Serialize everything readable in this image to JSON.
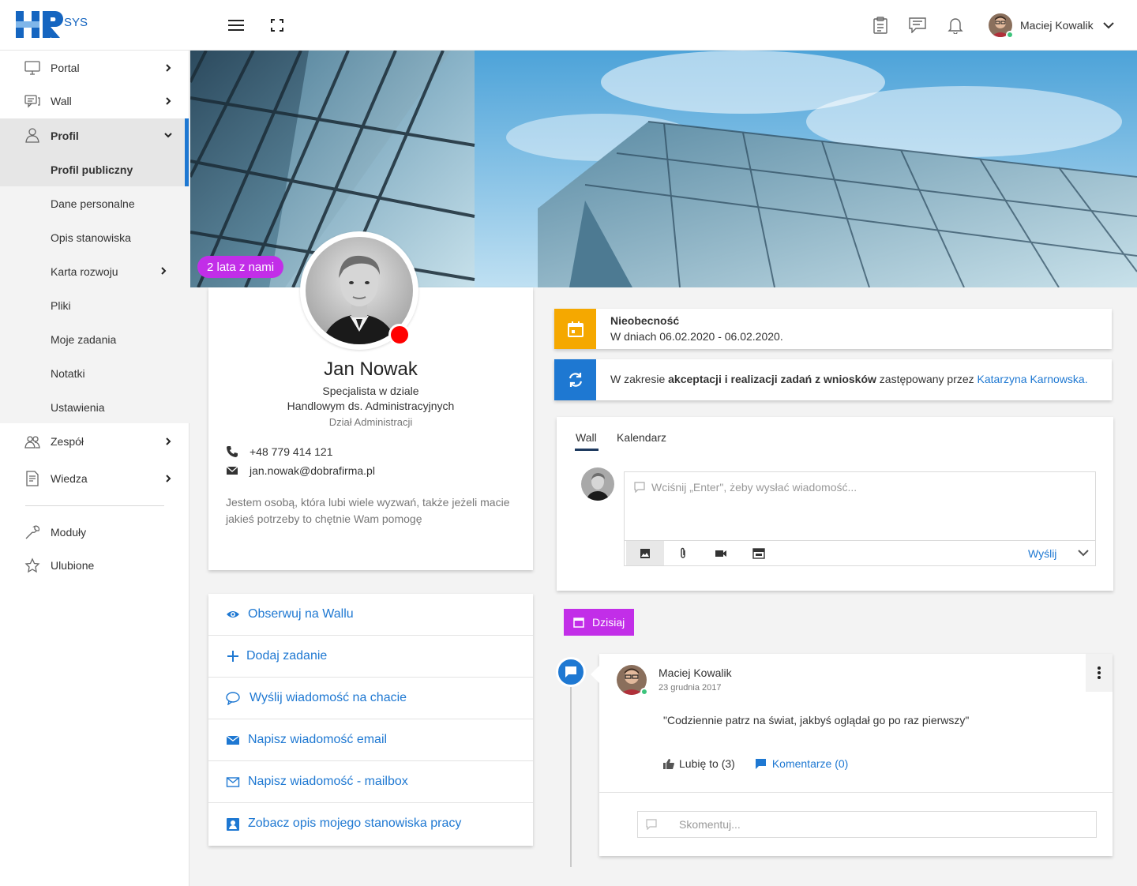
{
  "header": {
    "logo_text": "HR",
    "logo_suffix": "SYS",
    "user_name": "Maciej Kowalik"
  },
  "sidebar": {
    "items": [
      {
        "label": "Portal"
      },
      {
        "label": "Wall"
      },
      {
        "label": "Profil"
      },
      {
        "label": "Zespół"
      },
      {
        "label": "Wiedza"
      },
      {
        "label": "Moduły"
      },
      {
        "label": "Ulubione"
      }
    ],
    "sub_items": [
      {
        "label": "Profil publiczny"
      },
      {
        "label": "Dane personalne"
      },
      {
        "label": "Opis stanowiska"
      },
      {
        "label": "Karta rozwoju"
      },
      {
        "label": "Pliki"
      },
      {
        "label": "Moje zadania"
      },
      {
        "label": "Notatki"
      },
      {
        "label": "Ustawienia"
      }
    ]
  },
  "profile": {
    "badge": "2 lata z nami",
    "name": "Jan Nowak",
    "title_line1": "Specjalista w dziale",
    "title_line2": "Handlowym ds. Administracyjnych",
    "department": "Dział Administracji",
    "phone": "+48 779 414 121",
    "email": "jan.nowak@dobrafirma.pl",
    "bio": "Jestem osobą, która lubi wiele wyzwań, także jeżeli macie jakieś potrzeby to chętnie Wam pomogę"
  },
  "actions": [
    {
      "label": "Obserwuj na Wallu"
    },
    {
      "label": "Dodaj zadanie"
    },
    {
      "label": "Wyślij wiadomość na chacie"
    },
    {
      "label": "Napisz wiadomość email"
    },
    {
      "label": "Napisz wiadomość - mailbox"
    },
    {
      "label": "Zobacz opis mojego stanowiska pracy"
    }
  ],
  "notices": {
    "absence_title": "Nieobecność",
    "absence_text": "W dniach 06.02.2020 - 06.02.2020.",
    "sub_prefix": "W zakresie ",
    "sub_bold": "akceptacji i realizacji zadań z wniosków",
    "sub_middle": " zastępowany przez ",
    "sub_link": "Katarzyna Karnowska."
  },
  "wall": {
    "tabs": [
      {
        "label": "Wall"
      },
      {
        "label": "Kalendarz"
      }
    ],
    "placeholder": "Wciśnij „Enter\", żeby wysłać wiadomość...",
    "send_label": "Wyślij"
  },
  "timeline": {
    "today_label": "Dzisiaj",
    "post": {
      "author": "Maciej Kowalik",
      "date": "23 grudnia 2017",
      "text": "\"Codziennie patrz na świat, jakbyś oglądał go po raz pierwszy\"",
      "like_label": "Lubię to (3)",
      "comments_label": "Komentarze (0)",
      "comment_placeholder": "Skomentuj..."
    }
  },
  "colors": {
    "accent": "#1e78d2",
    "badge": "#c22ee8",
    "absence": "#f5a800",
    "status_offline": "#ff0000",
    "status_online": "#3cc47c"
  }
}
